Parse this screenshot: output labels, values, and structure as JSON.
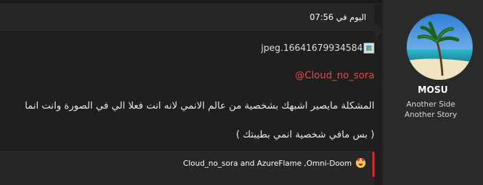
{
  "post": {
    "date": "اليوم في 07:56",
    "image_alt": "jpeg.16641679934584",
    "mention": "@Cloud_no_sora",
    "line1": "المشكلة مايصير اشبهك بشخصية من عالم الانمي لانه انت فعلا الي في الصورة وانت انما",
    "line2": "( بس مافي شخصية انمي بطيبتك )"
  },
  "user": {
    "name": "MOSU",
    "title": "Another Side Another Story"
  },
  "reactions": {
    "text": "Cloud_no_sora and AzureFlame ,Omni-Doom",
    "emoji_icon": "heart-eyes-emoji-icon"
  },
  "colors": {
    "mention": "#e04b4b",
    "reaction_bar": "#d12f2f"
  }
}
